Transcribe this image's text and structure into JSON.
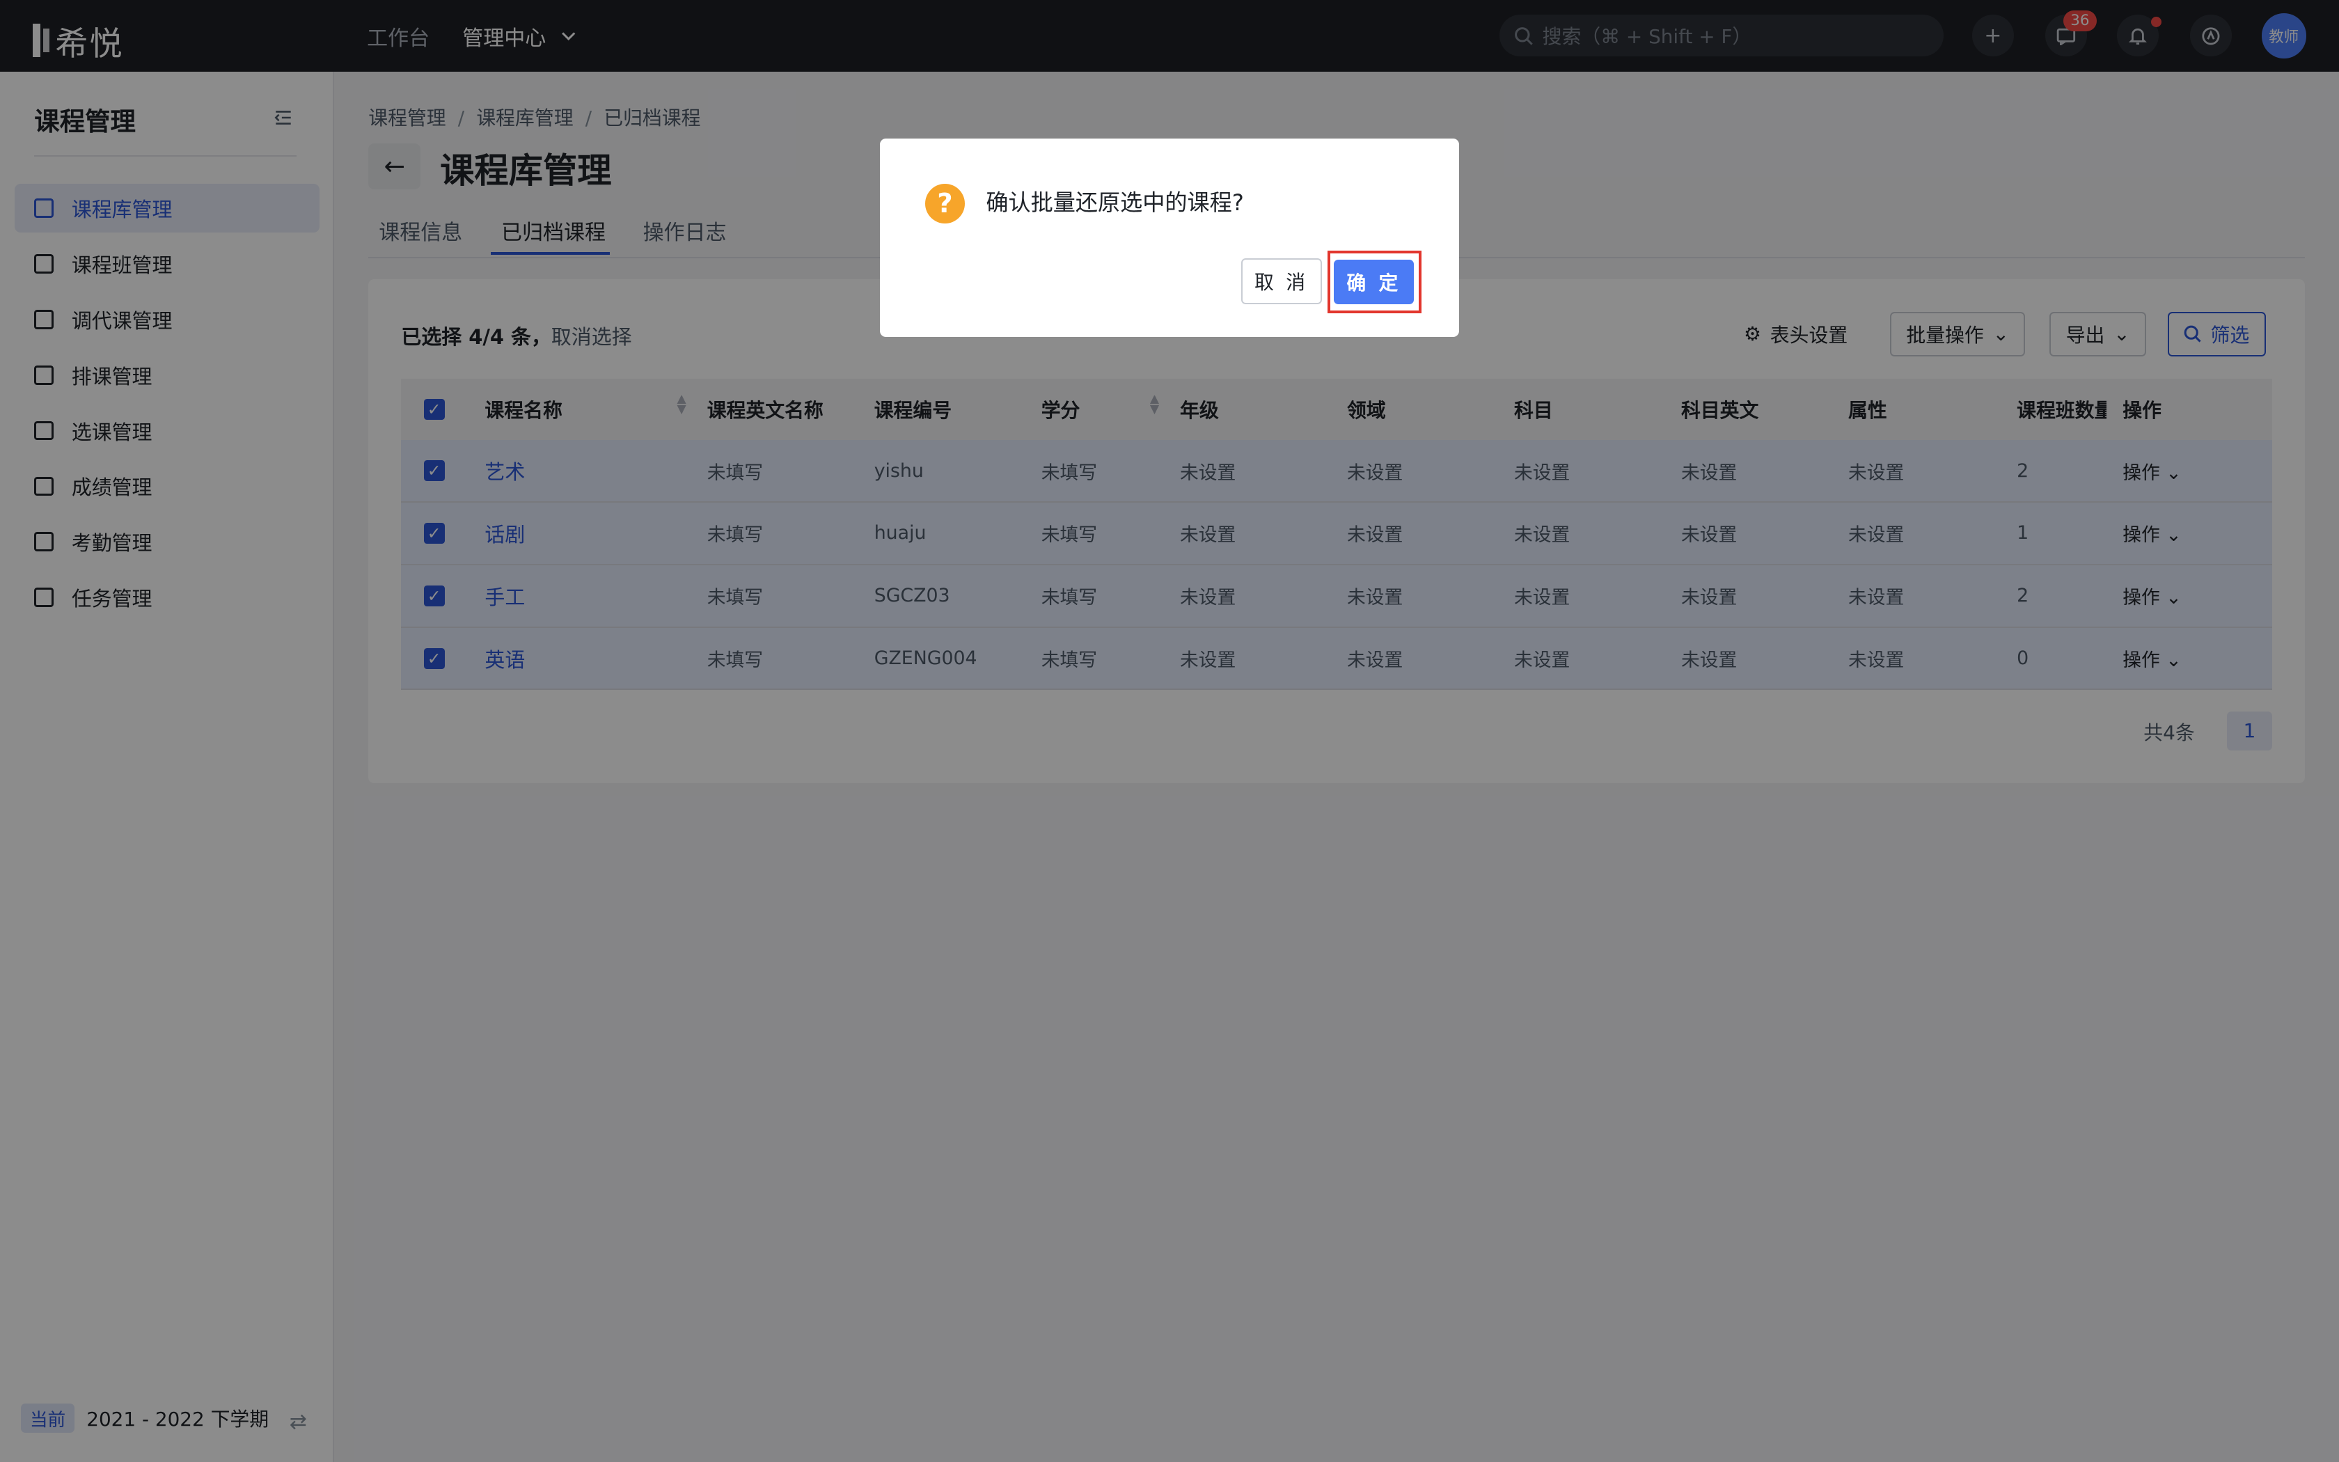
{
  "header": {
    "logo_text": "希悦",
    "nav": [
      "工作台",
      "管理中心"
    ],
    "search_placeholder": "搜索（⌘ + Shift + F）",
    "message_count": "36",
    "avatar_text": "教师"
  },
  "sidebar": {
    "title": "课程管理",
    "items": [
      {
        "label": "课程库管理",
        "active": true
      },
      {
        "label": "课程班管理"
      },
      {
        "label": "调代课管理"
      },
      {
        "label": "排课管理"
      },
      {
        "label": "选课管理"
      },
      {
        "label": "成绩管理"
      },
      {
        "label": "考勤管理"
      },
      {
        "label": "任务管理"
      }
    ],
    "footer_tag": "当前",
    "footer_term": "2021 - 2022 下学期"
  },
  "breadcrumb": [
    "课程管理",
    "课程库管理",
    "已归档课程"
  ],
  "page_title": "课程库管理",
  "tabs": [
    "课程信息",
    "已归档课程",
    "操作日志"
  ],
  "toolbar": {
    "selection_text": "已选择 4/4 条，",
    "clear_selection": "取消选择",
    "column_settings": "表头设置",
    "batch_ops": "批量操作",
    "export": "导出",
    "filter": "筛选"
  },
  "table": {
    "columns": [
      "课程名称",
      "课程英文名称",
      "课程编号",
      "学分",
      "年级",
      "领域",
      "科目",
      "科目英文",
      "属性",
      "课程班数量",
      "操作"
    ],
    "rows": [
      [
        "艺术",
        "未填写",
        "yishu",
        "未填写",
        "未设置",
        "未设置",
        "未设置",
        "未设置",
        "未设置",
        "2",
        "操作"
      ],
      [
        "话剧",
        "未填写",
        "huaju",
        "未填写",
        "未设置",
        "未设置",
        "未设置",
        "未设置",
        "未设置",
        "1",
        "操作"
      ],
      [
        "手工",
        "未填写",
        "SGCZ03",
        "未填写",
        "未设置",
        "未设置",
        "未设置",
        "未设置",
        "未设置",
        "2",
        "操作"
      ],
      [
        "英语",
        "未填写",
        "GZENG004",
        "未填写",
        "未设置",
        "未设置",
        "未设置",
        "未设置",
        "未设置",
        "0",
        "操作"
      ]
    ],
    "total_text": "共4条",
    "page": "1"
  },
  "dialog": {
    "message": "确认批量还原选中的课程?",
    "cancel": "取 消",
    "confirm": "确 定"
  }
}
